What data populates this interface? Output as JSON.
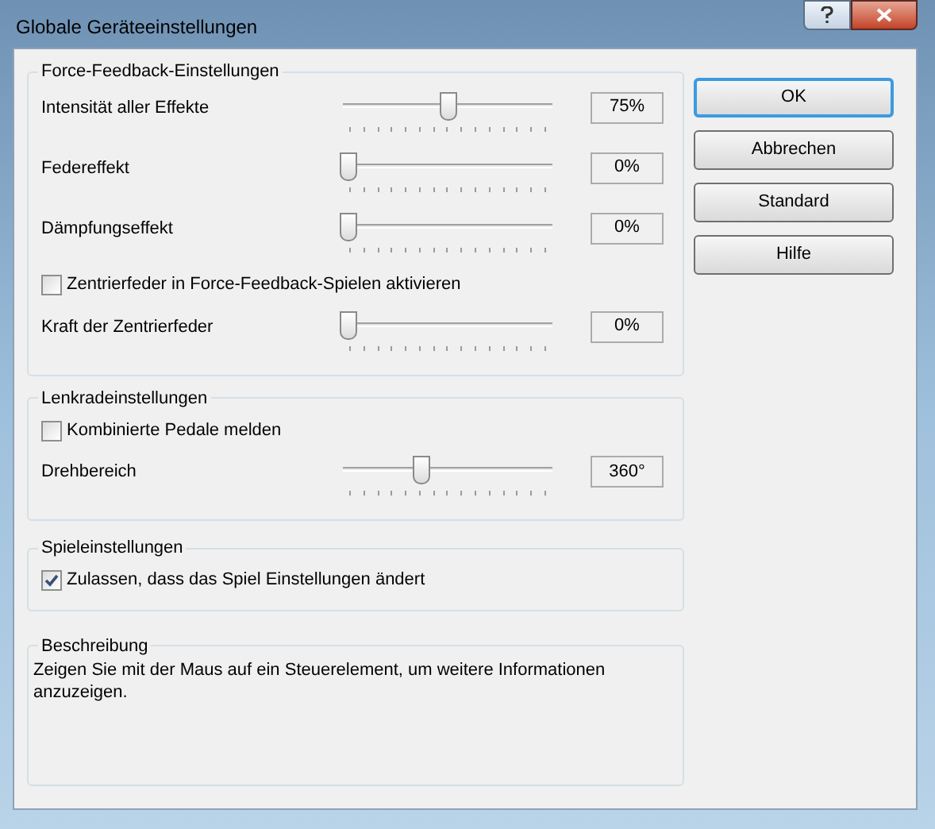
{
  "window": {
    "title": "Globale Geräteeinstellungen"
  },
  "groups": [
    {
      "title": "Force-Feedback-Einstellungen",
      "rows": [
        {
          "kind": "slider",
          "label": "Intensität aller Effekte",
          "level": 0.5,
          "reading": "75%"
        },
        {
          "kind": "slider",
          "label": "Federeffekt",
          "level": 0,
          "reading": "0%"
        },
        {
          "kind": "slider",
          "label": "Dämpfungseffekt",
          "level": 0,
          "reading": "0%"
        },
        {
          "kind": "checkbox",
          "label": "Zentrierfeder in Force-Feedback-Spielen aktivieren",
          "checked": false
        },
        {
          "kind": "slider",
          "label": "Kraft der Zentrierfeder",
          "level": 0,
          "reading": "0%"
        }
      ]
    },
    {
      "title": "Lenkradeinstellungen",
      "rows": [
        {
          "kind": "checkbox",
          "label": "Kombinierte Pedale melden",
          "checked": false
        },
        {
          "kind": "slider",
          "label": "Drehbereich",
          "level": 0.37,
          "reading": "360°"
        }
      ]
    },
    {
      "title": "Spieleinstellungen",
      "rows": [
        {
          "kind": "checkbox",
          "label": "Zulassen, dass das Spiel Einstellungen ändert",
          "checked": true
        }
      ]
    },
    {
      "title": "Beschreibung",
      "rows": [
        {
          "kind": "text",
          "label": "Zeigen Sie mit der Maus auf ein Steuerelement, um weitere Informationen anzuzeigen."
        }
      ]
    }
  ],
  "buttons": [
    {
      "label": "OK",
      "default": true
    },
    {
      "label": "Abbrechen",
      "default": false
    },
    {
      "label": "Standard",
      "default": false
    },
    {
      "label": "Hilfe",
      "default": false
    }
  ]
}
